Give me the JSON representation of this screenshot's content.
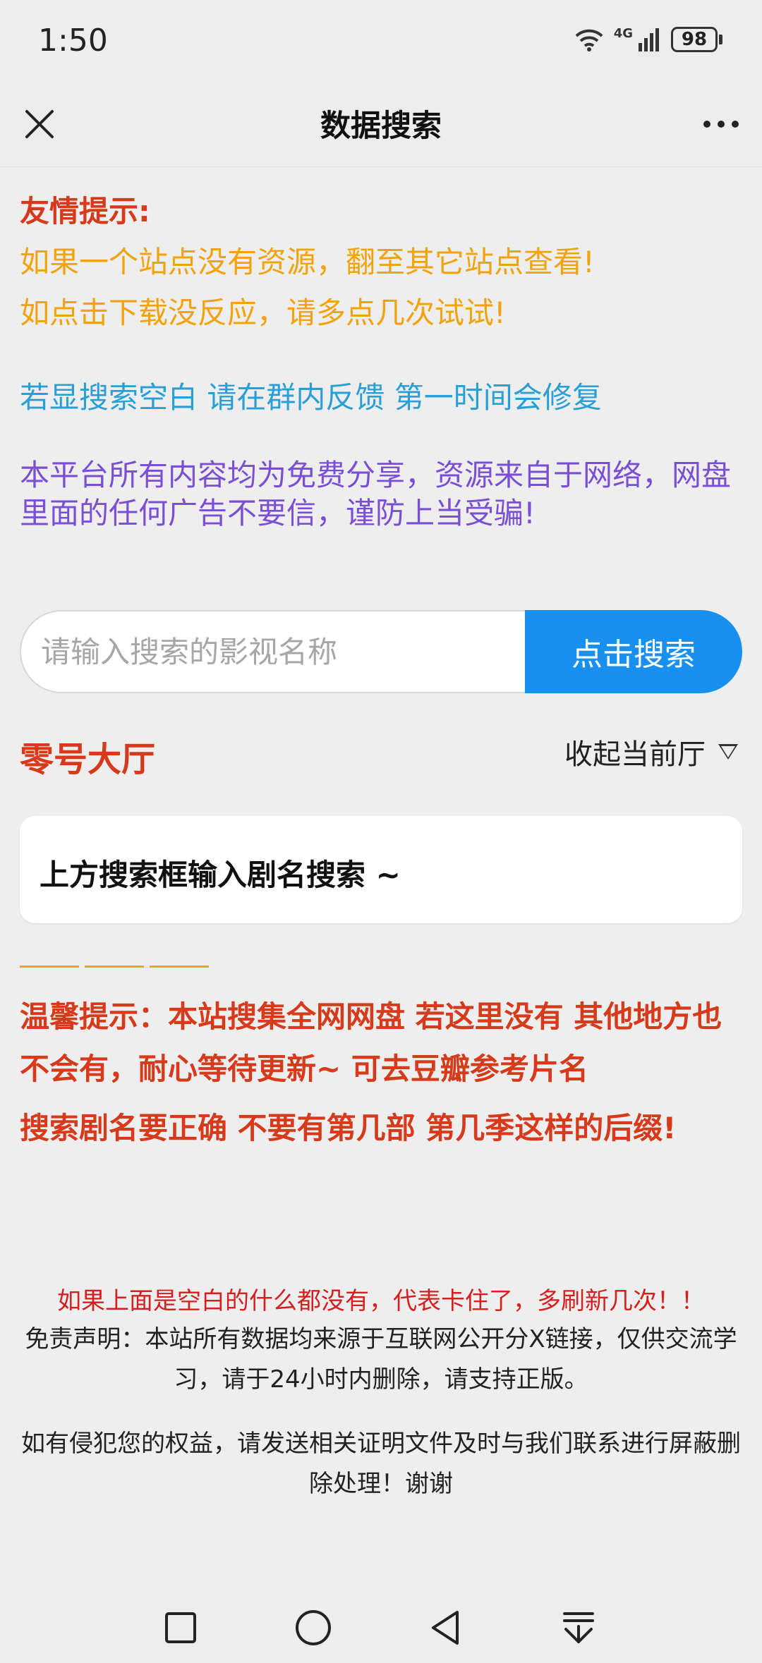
{
  "status": {
    "time": "1:50",
    "network": "4G",
    "battery": "98"
  },
  "nav": {
    "title": "数据搜索"
  },
  "tips": {
    "heading": "友情提示:",
    "line1": "如果一个站点没有资源，翻至其它站点查看!",
    "line2": "如点击下载没反应，请多点几次试试!",
    "line3": "若显搜索空白 请在群内反馈 第一时间会修复",
    "line4": "本平台所有内容均为免费分享，资源来自于网络，网盘里面的任何广告不要信，谨防上当受骗!"
  },
  "search": {
    "placeholder": "请输入搜索的影视名称",
    "button": "点击搜索"
  },
  "hall": {
    "title": "零号大厅",
    "collapse_label": "收起当前厅"
  },
  "result": {
    "text": "上方搜索框输入剧名搜索 ~"
  },
  "warm": {
    "para1": "温馨提示：本站搜集全网网盘 若这里没有 其他地方也不会有，耐心等待更新~ 可去豆瓣参考片名",
    "para2": "搜索剧名要正确 不要有第几部 第几季这样的后缀!"
  },
  "footer": {
    "refresh_note": "如果上面是空白的什么都没有，代表卡住了，多刷新几次！！",
    "disclaimer": "免责声明：本站所有数据均来源于互联网公开分X链接，仅供交流学习，请于24小时内删除，请支持正版。",
    "infringe": "如有侵犯您的权益，请发送相关证明文件及时与我们联系进行屏蔽删除处理！谢谢"
  },
  "colors": {
    "red": "#d63a1a",
    "orange": "#f2a20d",
    "blue": "#2a9fd6",
    "purple": "#7b4fd3",
    "button_blue": "#1890f0"
  },
  "icons": [
    "close-icon",
    "more-icon",
    "wifi-icon",
    "signal-icon",
    "battery-icon",
    "square-icon",
    "circle-icon",
    "back-triangle-icon",
    "down-menu-icon",
    "triangle-down-icon"
  ]
}
